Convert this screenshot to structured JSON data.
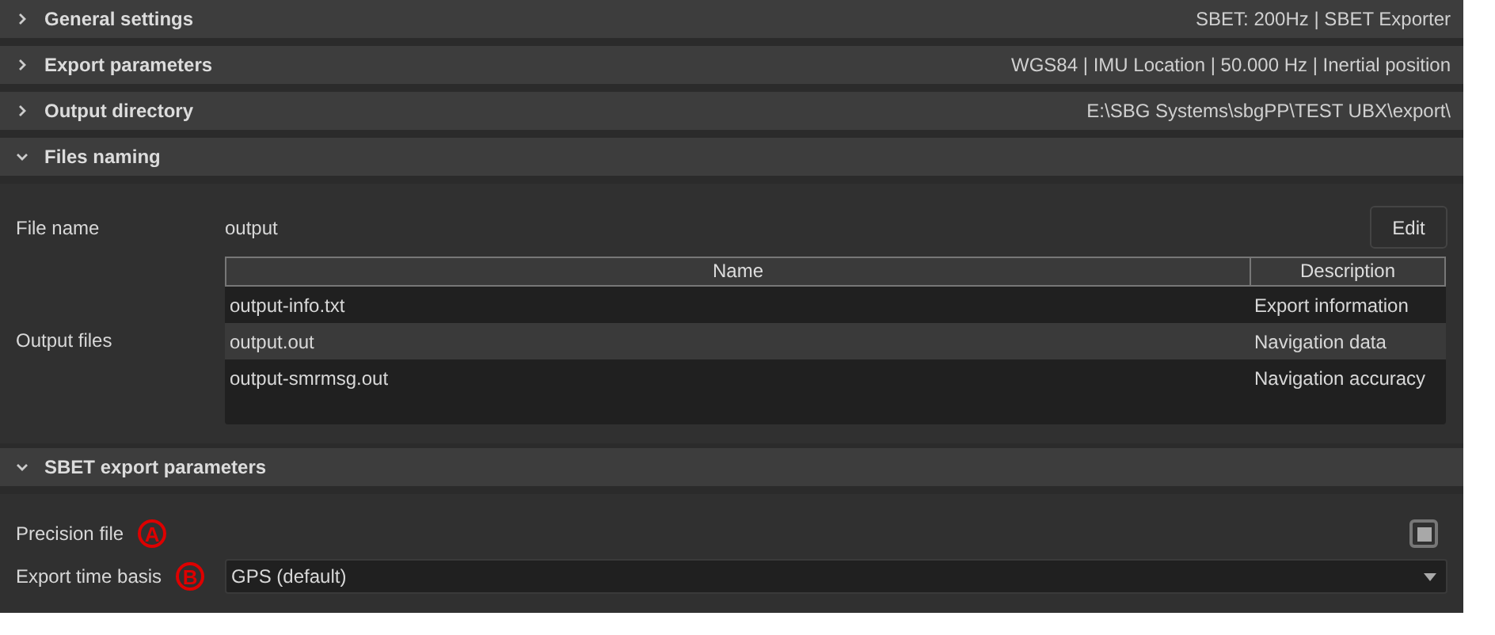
{
  "sections": [
    {
      "title": "General settings",
      "summary": "SBET: 200Hz | SBET Exporter",
      "expanded": false
    },
    {
      "title": "Export parameters",
      "summary": "WGS84 | IMU Location | 50.000 Hz | Inertial position",
      "expanded": false
    },
    {
      "title": "Output directory",
      "summary": "E:\\SBG Systems\\sbgPP\\TEST UBX\\export\\",
      "expanded": false
    },
    {
      "title": "Files naming",
      "expanded": true,
      "fields": [
        {
          "kind": "text_edit",
          "label": "File name",
          "value": "output",
          "button": "Edit"
        },
        {
          "kind": "table",
          "label": "Output files",
          "columns": [
            "Name",
            "Description"
          ],
          "rows": [
            {
              "cells": [
                "output-info.txt",
                "Export information"
              ],
              "selected": false
            },
            {
              "cells": [
                "output.out",
                "Navigation data"
              ],
              "selected": true
            },
            {
              "cells": [
                "output-smrmsg.out",
                "Navigation accuracy"
              ],
              "selected": false
            }
          ]
        }
      ]
    },
    {
      "title": "SBET export parameters",
      "expanded": true,
      "fields": [
        {
          "kind": "checkbox",
          "label": "Precision file",
          "marker": "A",
          "checked": true
        },
        {
          "kind": "dropdown",
          "label": "Export time basis",
          "marker": "B",
          "value": "GPS (default)"
        }
      ]
    }
  ]
}
